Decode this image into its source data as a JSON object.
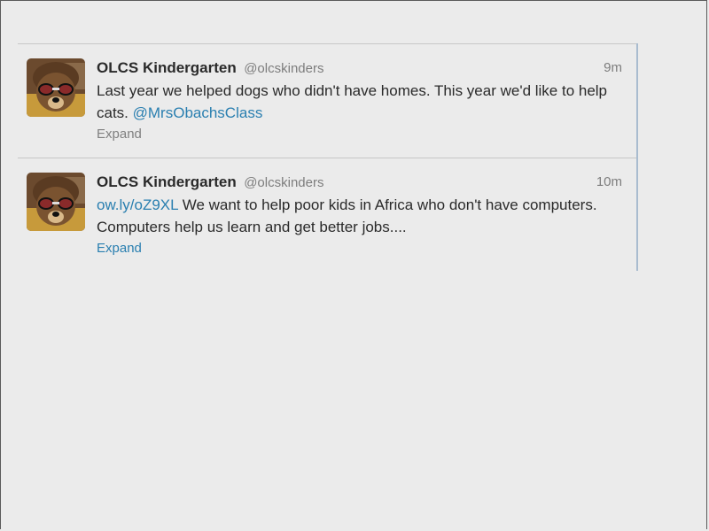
{
  "tweets": [
    {
      "display_name": "OLCS Kindergarten",
      "username": "@olcskinders",
      "time": "9m",
      "text_before_link": "Last year we helped dogs who didn't have homes. This year we'd like to help cats.",
      "link": "@MrsObachsClass",
      "text_after_link": "",
      "expand_label": "Expand",
      "expand_color": "#808080"
    },
    {
      "display_name": "OLCS Kindergarten",
      "username": "@olcskinders",
      "time": "10m",
      "text_before_link": "",
      "link": "ow.ly/oZ9XL",
      "text_after_link": " We want to help poor kids in Africa who don't have computers. Computers help us learn and get better jobs....",
      "expand_label": "Expand",
      "expand_color": "#2a7fb0"
    }
  ],
  "colors": {
    "link": "#2a7fb0",
    "text": "#2a2a2a",
    "muted": "#7d7d7d",
    "background": "#ebebeb"
  }
}
